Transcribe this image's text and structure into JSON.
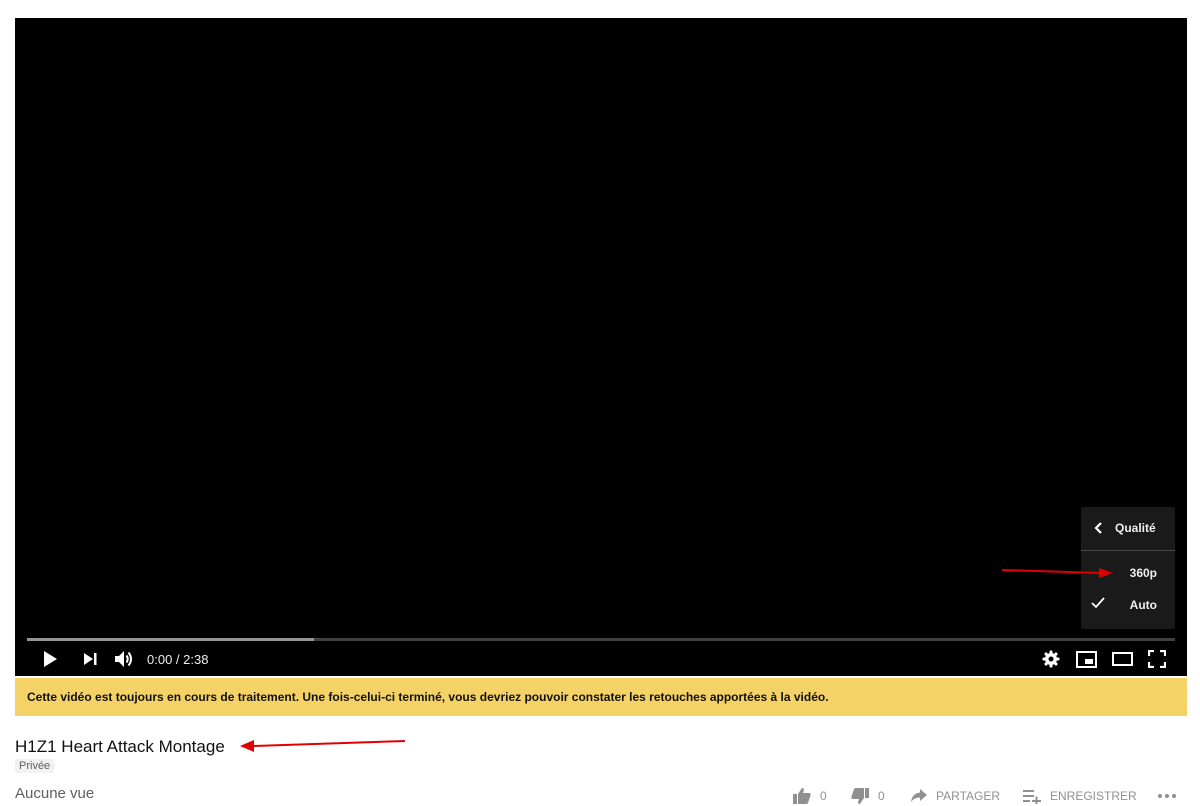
{
  "player": {
    "current_time": "0:00",
    "duration": "2:38",
    "time_display": "0:00 / 2:38",
    "progress_fraction": 0.0,
    "buffered_fraction": 0.25
  },
  "quality_menu": {
    "title": "Qualité",
    "options": [
      {
        "label": "360p",
        "selected": false
      },
      {
        "label": "Auto",
        "selected": true
      }
    ]
  },
  "banner": {
    "text": "Cette vidéo est toujours en cours de traitement. Une fois-celui-ci terminé, vous devriez pouvoir constater les retouches apportées à la vidéo.",
    "color": "#f5d266"
  },
  "video": {
    "title": "H1Z1 Heart Attack Montage",
    "privacy": "Privée",
    "views": "Aucune vue"
  },
  "actions": {
    "likes": "0",
    "dislikes": "0",
    "share_label": "PARTAGER",
    "save_label": "ENREGISTRER"
  },
  "icons": {
    "play": "play-icon",
    "next": "next-icon",
    "volume": "volume-icon",
    "settings": "gear-icon",
    "miniplayer": "miniplayer-icon",
    "theater": "theater-mode-icon",
    "fullscreen": "fullscreen-icon",
    "back": "chevron-left-icon",
    "check": "checkmark-icon",
    "like": "thumbs-up-icon",
    "dislike": "thumbs-down-icon",
    "share": "share-arrow-icon",
    "save": "playlist-add-icon",
    "more": "more-horiz-icon"
  },
  "annotation_color": "#e00000"
}
